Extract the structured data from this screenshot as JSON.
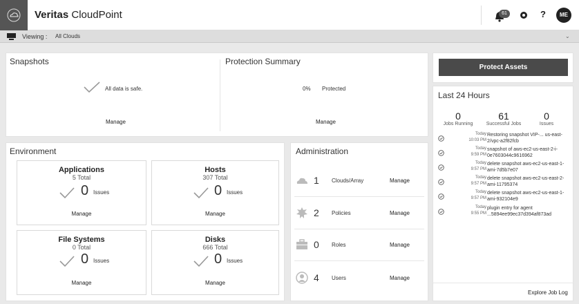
{
  "header": {
    "brand_bold": "Veritas",
    "brand_rest": " CloudPoint",
    "notification_count": "61",
    "help_label": "?",
    "avatar_initials": "ME"
  },
  "viewbar": {
    "label": "Viewing :",
    "value": "All Clouds"
  },
  "snapshots": {
    "title": "Snapshots",
    "status": "All data is safe.",
    "manage": "Manage"
  },
  "protection": {
    "title": "Protection Summary",
    "percent": "0%",
    "status": "Protected",
    "manage": "Manage"
  },
  "environment": {
    "title": "Environment",
    "cards": [
      {
        "title": "Applications",
        "total": "5 Total",
        "count": "0",
        "issues": "Issues",
        "manage": "Manage"
      },
      {
        "title": "Hosts",
        "total": "307 Total",
        "count": "0",
        "issues": "Issues",
        "manage": "Manage"
      },
      {
        "title": "File Systems",
        "total": "0 Total",
        "count": "0",
        "issues": "Issues",
        "manage": "Manage"
      },
      {
        "title": "Disks",
        "total": "666 Total",
        "count": "0",
        "issues": "Issues",
        "manage": "Manage"
      }
    ]
  },
  "administration": {
    "title": "Administration",
    "rows": [
      {
        "icon": "cloud-icon",
        "count": "1",
        "label": "Clouds/Array",
        "manage": "Manage"
      },
      {
        "icon": "policy-icon",
        "count": "2",
        "label": "Policies",
        "manage": "Manage"
      },
      {
        "icon": "briefcase-icon",
        "count": "0",
        "label": "Roles",
        "manage": "Manage"
      },
      {
        "icon": "user-icon",
        "count": "4",
        "label": "Users",
        "manage": "Manage"
      }
    ]
  },
  "right": {
    "protect_button": "Protect Assets",
    "title": "Last 24 Hours",
    "stats": [
      {
        "value": "0",
        "label": "Jobs Running"
      },
      {
        "value": "61",
        "label": "Successful Jobs"
      },
      {
        "value": "0",
        "label": "Issues"
      }
    ],
    "jobs": [
      {
        "day": "Today",
        "time": "10:03 PM",
        "desc": "Restoring snapshot VIP-... us-east-2/vpc-a2f82fcb"
      },
      {
        "day": "Today",
        "time": "9:59 PM",
        "desc": "snapshot of aws-ec2-us-east-2-i-0e7603044c9616962"
      },
      {
        "day": "Today",
        "time": "9:57 PM",
        "desc": "delete snapshot aws-ec2-us-east-1-ami-7d5b7e07"
      },
      {
        "day": "Today",
        "time": "9:57 PM",
        "desc": "delete snapshot aws-ec2-us-east-2-ami-11795374"
      },
      {
        "day": "Today",
        "time": "9:57 PM",
        "desc": "delete snapshot aws-ec2-us-east-1-ami-932104e9"
      },
      {
        "day": "Today",
        "time": "9:55 PM",
        "desc": "plugin entry for agent ...5894ee99ec37d394af873ad"
      }
    ],
    "explore_link": "Explore Job Log"
  },
  "colors": {
    "header_bg": "#ffffff",
    "page_bg": "#e9e9e9",
    "primary_button": "#4a4a4a",
    "check": "#999999"
  }
}
